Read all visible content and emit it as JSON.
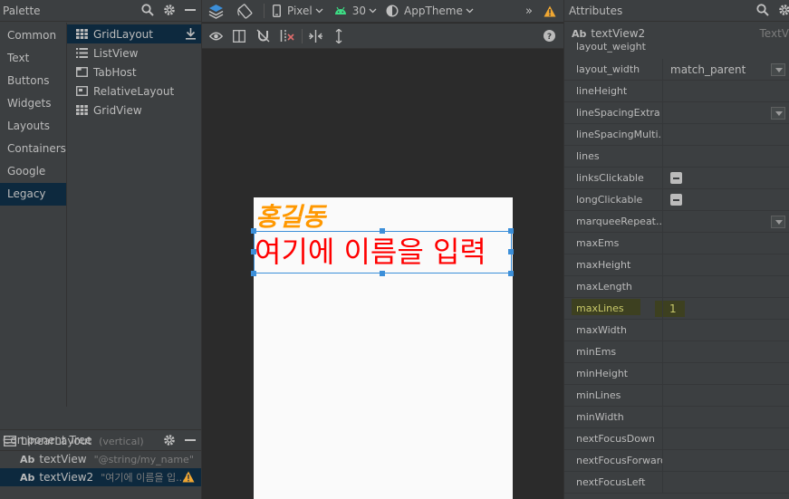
{
  "palette": {
    "title": "Palette",
    "categories": [
      "Common",
      "Text",
      "Buttons",
      "Widgets",
      "Layouts",
      "Containers",
      "Google",
      "Legacy"
    ],
    "selected_category": "Legacy",
    "items": [
      "GridLayout",
      "ListView",
      "TabHost",
      "RelativeLayout",
      "GridView"
    ]
  },
  "component_tree": {
    "title": "Component Tree",
    "root": {
      "label": "LinearLayout",
      "detail": "(vertical)"
    },
    "children": [
      {
        "label": "textView",
        "detail": "\"@string/my_name\""
      },
      {
        "label": "textView2",
        "detail": "\"여기에 이름을 입...\""
      }
    ]
  },
  "toolbar": {
    "device": "Pixel",
    "api": "30",
    "theme": "AppTheme",
    "overflow": "»"
  },
  "preview": {
    "text1": "홍길동",
    "text2": "여기에 이름을 입력",
    "text1_color": "#ff9800",
    "text2_color": "#ff0000"
  },
  "attributes": {
    "title": "Attributes",
    "component_icon": "Ab",
    "component_name": "textView2",
    "component_type": "TextV",
    "rows": [
      {
        "name": "layout_weight",
        "value": ""
      },
      {
        "name": "layout_width",
        "value": "match_parent"
      },
      {
        "name": "lineHeight",
        "value": ""
      },
      {
        "name": "lineSpacingExtra",
        "value": ""
      },
      {
        "name": "lineSpacingMulti...",
        "value": ""
      },
      {
        "name": "lines",
        "value": ""
      },
      {
        "name": "linksClickable",
        "value": ""
      },
      {
        "name": "longClickable",
        "value": ""
      },
      {
        "name": "marqueeRepeat...",
        "value": ""
      },
      {
        "name": "maxEms",
        "value": ""
      },
      {
        "name": "maxHeight",
        "value": ""
      },
      {
        "name": "maxLength",
        "value": ""
      },
      {
        "name": "maxLines",
        "value": "1"
      },
      {
        "name": "maxWidth",
        "value": ""
      },
      {
        "name": "minEms",
        "value": ""
      },
      {
        "name": "minHeight",
        "value": ""
      },
      {
        "name": "minLines",
        "value": ""
      },
      {
        "name": "minWidth",
        "value": ""
      },
      {
        "name": "nextFocusDown",
        "value": ""
      },
      {
        "name": "nextFocusForward",
        "value": ""
      },
      {
        "name": "nextFocusLeft",
        "value": ""
      }
    ]
  },
  "colors": {
    "accent": "#3c8fd9",
    "warning": "#f0a732",
    "android_green": "#3ddc84"
  }
}
